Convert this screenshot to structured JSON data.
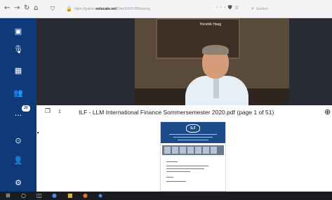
{
  "browser": {
    "url_prefix": "https://jyalmir.",
    "url_host": "netucate.net",
    "url_path": "/Dim/IFR0IV8Mannng",
    "search_placeholder": "Suchen"
  },
  "sidebar": {
    "items": [
      {
        "icon": "camera-toggle-icon"
      },
      {
        "icon": "microphone-icon"
      },
      {
        "icon": "layout-icon"
      },
      {
        "icon": "participants-icon",
        "badge": "20"
      },
      {
        "icon": "more-icon"
      },
      {
        "icon": "record-icon"
      },
      {
        "icon": "add-user-icon"
      },
      {
        "icon": "settings-icon"
      }
    ]
  },
  "video": {
    "speaker_name": "Hendrik Haag"
  },
  "presentation": {
    "page_count": "1",
    "title": "ILF - LLM International Finance Sommersemester 2020.pdf (page 1 of 51)",
    "slide_logo": "ILF"
  },
  "colors": {
    "sidebar": "#0e3a7a",
    "stage": "#2a2c34",
    "slide_header": "#1c4b8c",
    "taskbar": "#1a1c22"
  }
}
